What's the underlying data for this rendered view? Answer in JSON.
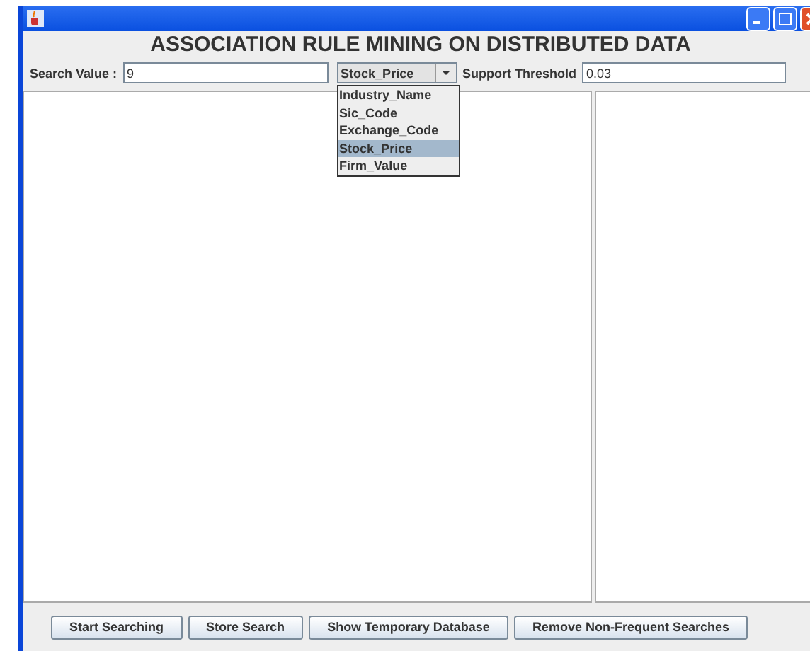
{
  "heading": "ASSOCIATION RULE MINING ON DISTRIBUTED DATA",
  "search": {
    "label": "Search Value :",
    "value": "9"
  },
  "attribute_combo": {
    "value": "Stock_Price",
    "expanded": true,
    "options": [
      {
        "label": "Industry_Name",
        "selected": false
      },
      {
        "label": "Sic_Code",
        "selected": false
      },
      {
        "label": "Exchange_Code",
        "selected": false
      },
      {
        "label": "Stock_Price",
        "selected": true
      },
      {
        "label": "Firm_Value",
        "selected": false
      }
    ]
  },
  "support": {
    "label": "Support Threshold",
    "value": "0.03"
  },
  "buttons": [
    "Start Searching",
    "Store Search",
    "Show Temporary Database",
    "Remove Non-Frequent Searches"
  ]
}
